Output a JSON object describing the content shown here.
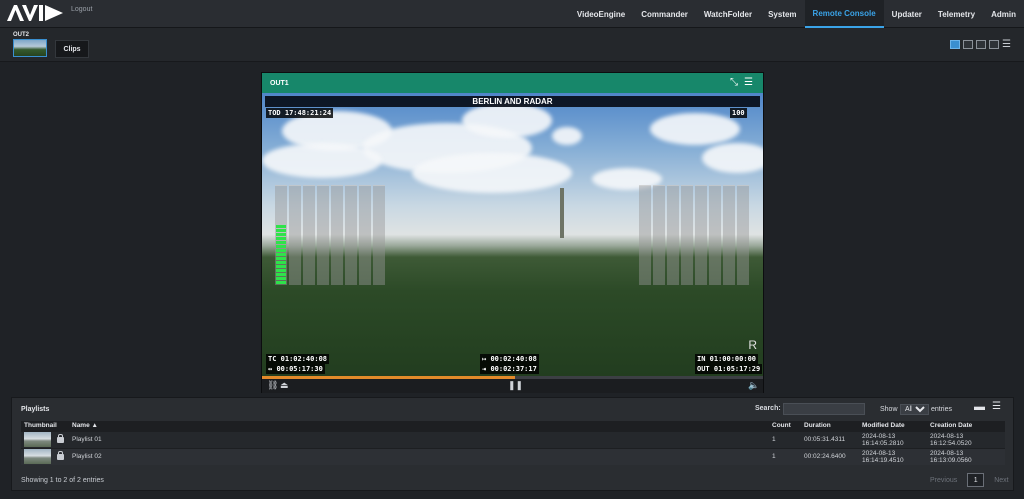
{
  "header": {
    "logo_text": "AVID",
    "logout": "Logout",
    "nav": [
      "VideoEngine",
      "Commander",
      "WatchFolder",
      "System",
      "Remote Console",
      "Updater",
      "Telemetry",
      "Admin"
    ],
    "active_nav": "Remote Console",
    "accent_color": "#3aa3e8"
  },
  "subbar": {
    "output_label": "OUT2",
    "clips_tab": "Clips",
    "layout_icons": [
      "single-view-icon",
      "dual-view-icon",
      "quad-view-icon",
      "multi-view-icon",
      "menu-icon"
    ]
  },
  "player": {
    "title": "OUT1",
    "header_color": "#17876a",
    "overlay_title": "BERLIN AND RADAR",
    "tod": "TOD 17:48:21:24",
    "volume": "100",
    "tc": "TC  01:02:40:08",
    "duration": "00:05:17:30",
    "elapsed": "00:02:40:08",
    "remaining": "00:02:37:17",
    "in_point": "IN   01:00:00:00",
    "out_point": "OUT 01:05:17:29",
    "record_flag": "R",
    "progress": 0.504
  },
  "playlists": {
    "title": "Playlists",
    "search_label": "Search:",
    "search_value": "",
    "show_label": "Show",
    "show_value": "All",
    "entries_label": "entries",
    "columns": [
      "Thumbnail",
      "Name",
      "Count",
      "Duration",
      "Modified Date",
      "Creation Date"
    ],
    "rows": [
      {
        "name": "Playlist 01",
        "count": "1",
        "duration": "00:05:31.4311",
        "modified_1": "2024-08-13",
        "modified_2": "16:14:05.2810",
        "created_1": "2024-08-13",
        "created_2": "16:12:54.0520"
      },
      {
        "name": "Playlist 02",
        "count": "1",
        "duration": "00:02:24.6400",
        "modified_1": "2024-08-13",
        "modified_2": "16:14:19.4510",
        "created_1": "2024-08-13",
        "created_2": "16:13:09.0560"
      }
    ],
    "footer": "Showing 1 to 2 of 2 entries",
    "prev": "Previous",
    "page": "1",
    "next": "Next"
  }
}
